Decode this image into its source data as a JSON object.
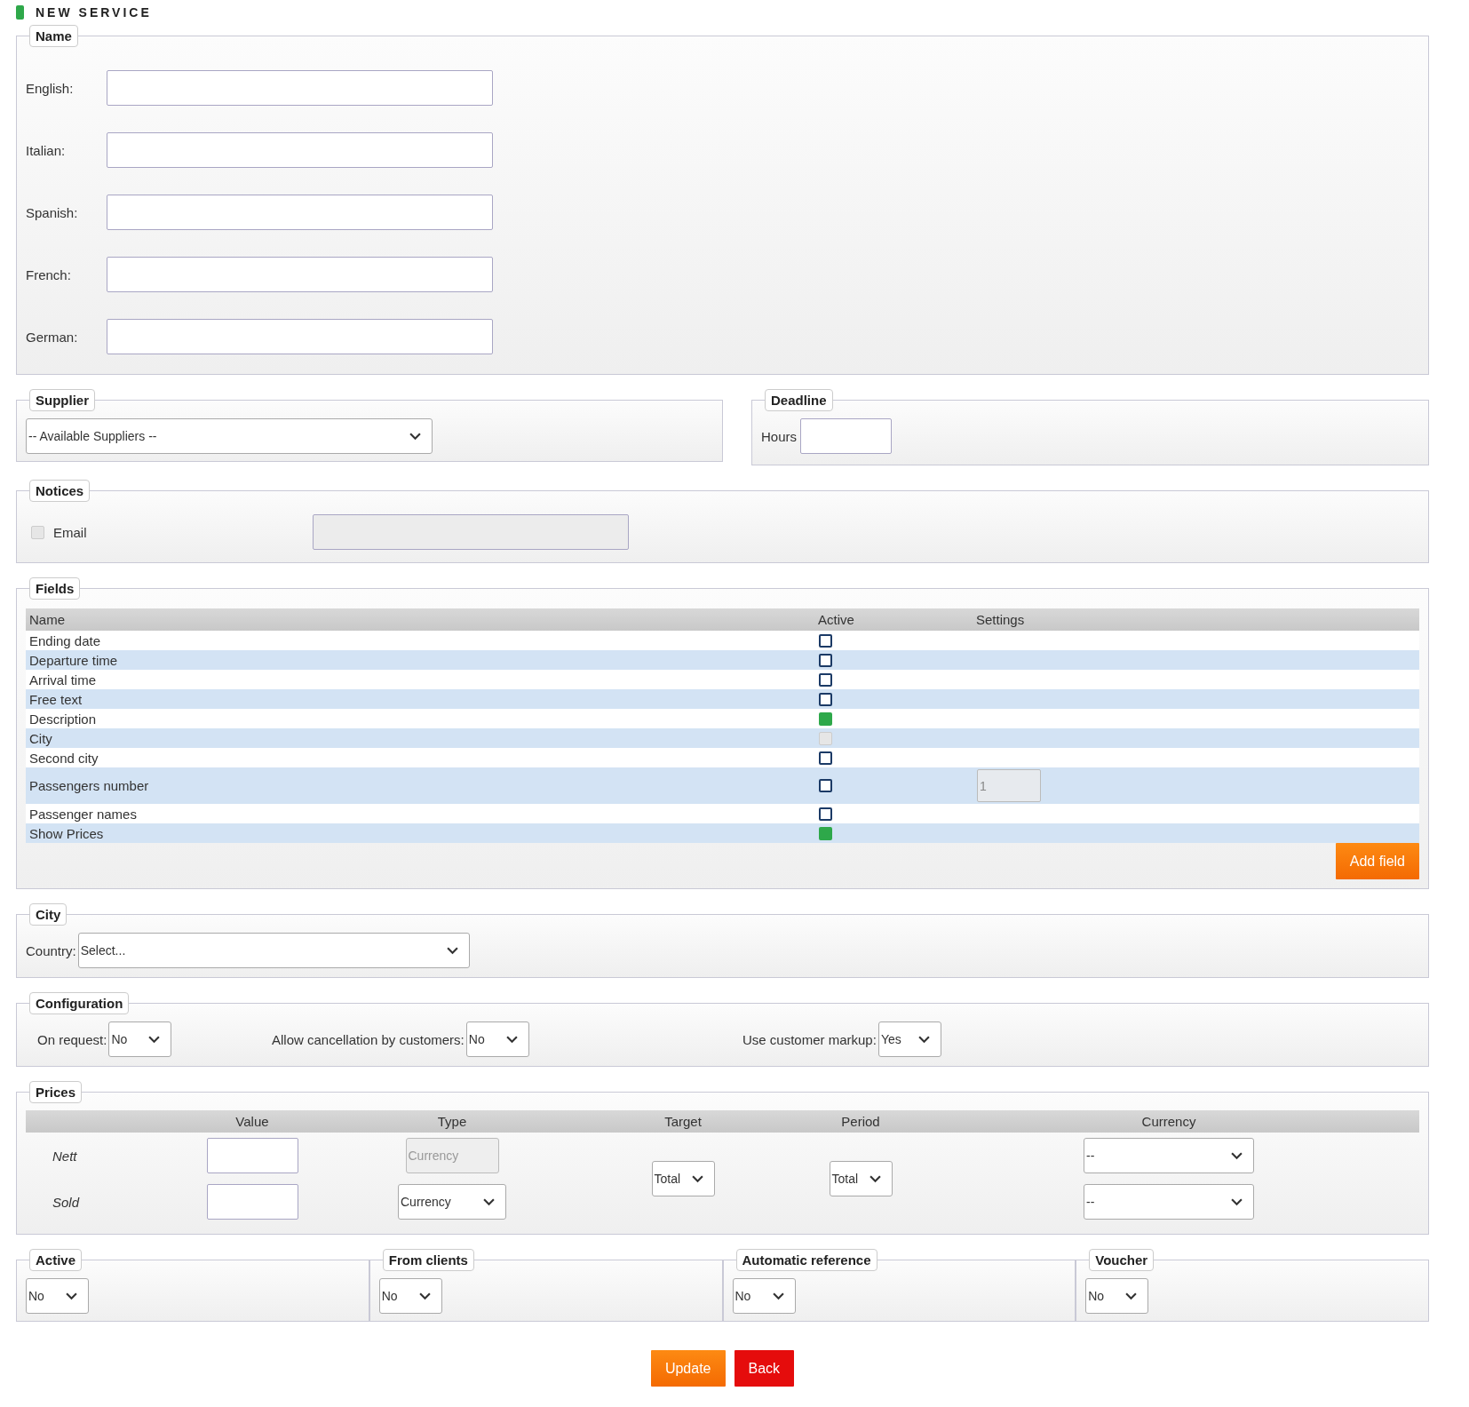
{
  "page_title": "NEW SERVICE",
  "name_section": {
    "legend": "Name",
    "fields": [
      {
        "label": "English:"
      },
      {
        "label": "Italian:"
      },
      {
        "label": "Spanish:"
      },
      {
        "label": "French:"
      },
      {
        "label": "German:"
      }
    ]
  },
  "supplier": {
    "legend": "Supplier",
    "select": "-- Available Suppliers --"
  },
  "deadline": {
    "legend": "Deadline",
    "label": "Hours"
  },
  "notices": {
    "legend": "Notices",
    "email_label": "Email",
    "email_checked": false,
    "email_disabled": true
  },
  "fields": {
    "legend": "Fields",
    "columns": [
      "Name",
      "Active",
      "Settings"
    ],
    "rows": [
      {
        "name": "Ending date",
        "checked": false,
        "disabled": false
      },
      {
        "name": "Departure time",
        "checked": false,
        "disabled": false
      },
      {
        "name": "Arrival time",
        "checked": false,
        "disabled": false
      },
      {
        "name": "Free text",
        "checked": false,
        "disabled": false
      },
      {
        "name": "Description",
        "checked": true,
        "disabled": false
      },
      {
        "name": "City",
        "checked": false,
        "disabled": true
      },
      {
        "name": "Second city",
        "checked": false,
        "disabled": false
      },
      {
        "name": "Passengers number",
        "checked": false,
        "disabled": false,
        "setting": "1"
      },
      {
        "name": "Passenger names",
        "checked": false,
        "disabled": false
      },
      {
        "name": "Show Prices",
        "checked": true,
        "disabled": false
      }
    ],
    "add_button": "Add field"
  },
  "city": {
    "legend": "City",
    "label": "Country:",
    "select": "Select..."
  },
  "configuration": {
    "legend": "Configuration",
    "items": [
      {
        "label": "On request:",
        "value": "No"
      },
      {
        "label": "Allow cancellation by customers:",
        "value": "No"
      },
      {
        "label": "Use customer markup:",
        "value": "Yes"
      }
    ]
  },
  "prices": {
    "legend": "Prices",
    "columns": [
      "Value",
      "Type",
      "Target",
      "Period",
      "Currency"
    ],
    "rows": [
      {
        "label": "Nett",
        "type": "Currency",
        "type_disabled": true,
        "currency": "--"
      },
      {
        "label": "Sold",
        "type": "Currency",
        "type_disabled": false,
        "currency": "--"
      }
    ],
    "target": "Total",
    "period": "Total"
  },
  "options": [
    {
      "legend": "Active",
      "value": "No"
    },
    {
      "legend": "From clients",
      "value": "No"
    },
    {
      "legend": "Automatic reference",
      "value": "No"
    },
    {
      "legend": "Voucher",
      "value": "No"
    }
  ],
  "buttons": [
    {
      "label": "Update",
      "kind": "primary"
    },
    {
      "label": "Back",
      "kind": "danger"
    }
  ]
}
